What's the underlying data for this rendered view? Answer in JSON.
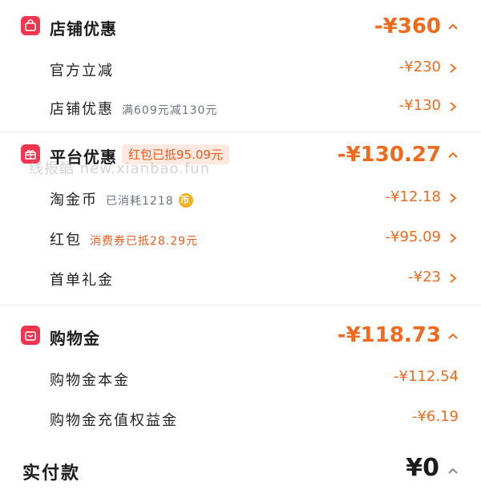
{
  "sections": [
    {
      "title": "店铺优惠",
      "amount": "-¥360",
      "icon": "shop-bag-icon",
      "rows": [
        {
          "label": "官方立减",
          "note": "",
          "amount": "-¥230"
        },
        {
          "label": "店铺优惠",
          "note": "满609元减130元",
          "amount": "-¥130"
        }
      ]
    },
    {
      "title": "平台优惠",
      "badge": "红包已抵95.09元",
      "amount": "-¥130.27",
      "icon": "gift-icon",
      "rows": [
        {
          "label": "淘金币",
          "note": "已消耗1218",
          "coin_glyph": "币",
          "amount": "-¥12.18"
        },
        {
          "label": "红包",
          "note": "消费券已抵28.29元",
          "amount": "-¥95.09"
        },
        {
          "label": "首单礼金",
          "note": "",
          "amount": "-¥23"
        }
      ]
    },
    {
      "title": "购物金",
      "amount": "-¥118.73",
      "icon": "wallet-icon",
      "rows": [
        {
          "label": "购物金本金",
          "amount": "-¥112.54"
        },
        {
          "label": "购物金充值权益金",
          "amount": "-¥6.19"
        }
      ]
    }
  ],
  "total": {
    "label": "实付款",
    "amount": "¥0"
  },
  "watermark": "线报酷 new.xianbao.fun",
  "colors": {
    "accent_orange": "#f06a1e",
    "icon_red": "#f2344e",
    "badge_bg": "#fde9df",
    "note_gray": "#6d7380"
  }
}
